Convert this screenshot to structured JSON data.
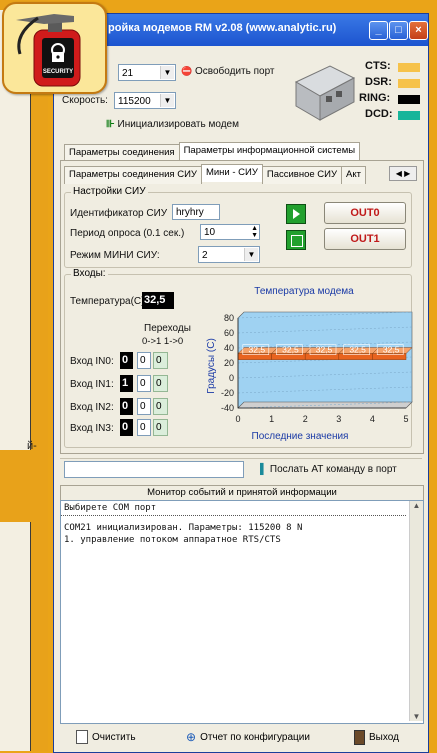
{
  "window": {
    "title": "ройка модемов RM v2.08 (www.analytic.ru)",
    "min_label": "_",
    "max_label": "□",
    "close_label": "×"
  },
  "badge": {
    "label": "SECURITY"
  },
  "left_caption": "й-",
  "port": {
    "com_value": "21",
    "release_label": "Освободить порт",
    "speed_label": "Скорость:",
    "speed_value": "115200",
    "init_label": "Инициализировать модем"
  },
  "signals": [
    {
      "name": "CTS:",
      "color": "#f6c24a"
    },
    {
      "name": "DSR:",
      "color": "#f6c24a"
    },
    {
      "name": "RING:",
      "color": "#000000"
    },
    {
      "name": "DCD:",
      "color": "#17b59a"
    }
  ],
  "tabs_main": [
    "Параметры соединения",
    "Параметры информационной системы"
  ],
  "tabs_sub": [
    "Параметры соединения СИУ",
    "Мини - СИУ",
    "Пассивное СИУ",
    "Акт"
  ],
  "settings": {
    "group_title": "Настройки СИУ",
    "id_label": "Идентификатор СИУ",
    "id_value": "hryhry",
    "period_label": "Период опроса (0.1 сек.)",
    "period_value": "10",
    "mode_label": "Режим МИНИ СИУ:",
    "mode_value": "2",
    "out0": "OUT0",
    "out1": "OUT1"
  },
  "inputs": {
    "group_title": "Входы:",
    "temp_label": "Температура(С):",
    "temp_value": "32,5",
    "transitions_label": "Переходы",
    "transitions_cols": "0->1  1->0",
    "rows": [
      {
        "label": "Вход IN0:",
        "state": "0",
        "up": "0",
        "down": "0"
      },
      {
        "label": "Вход IN1:",
        "state": "1",
        "up": "0",
        "down": "0"
      },
      {
        "label": "Вход IN2:",
        "state": "0",
        "up": "0",
        "down": "0"
      },
      {
        "label": "Вход IN3:",
        "state": "0",
        "up": "0",
        "down": "0"
      }
    ]
  },
  "chart_data": {
    "type": "bar",
    "title": "Температура модема",
    "ylabel": "Градусы (C)",
    "xlabel": "Последние значения",
    "ylim": [
      -40,
      80
    ],
    "yticks": [
      80,
      60,
      40,
      20,
      0,
      -20,
      -40
    ],
    "xlim": [
      0,
      5
    ],
    "xticks": [
      0,
      1,
      2,
      3,
      4,
      5
    ],
    "categories": [
      "1",
      "2",
      "3",
      "4",
      "5"
    ],
    "values": [
      32.5,
      32.5,
      32.5,
      32.5,
      32.5
    ],
    "data_labels": [
      "32,5",
      "32,5",
      "32,5",
      "32,5",
      "32,5"
    ],
    "bar_color": "#e8641f",
    "plot_color": "#9fd2f2"
  },
  "at": {
    "send_label": "Послать АТ команду в порт"
  },
  "monitor": {
    "title": "Монитор событий и принятой информации",
    "lines": [
      "Выбирете COM порт",
      "COM21 инициализирован. Параметры: 115200 8 N",
      "1. управление потоком аппаратное RTS/CTS"
    ]
  },
  "footer": {
    "clear_label": "Очистить",
    "report_label": "Отчет по конфигурации",
    "exit_label": "Выход"
  }
}
